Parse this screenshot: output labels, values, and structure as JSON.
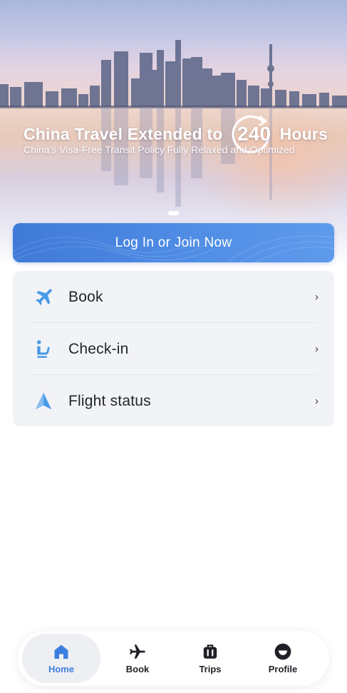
{
  "hero": {
    "title_before": "China Travel Extended to",
    "badge_number": "240",
    "title_after": "Hours",
    "subtitle": "China's Visa-Free Transit Policy Fully Relaxed and Optimized",
    "carousel": {
      "active_index": 0,
      "dot_count": 1
    }
  },
  "login": {
    "label": "Log In or Join Now"
  },
  "menu": {
    "items": [
      {
        "icon": "airplane-icon",
        "label": "Book",
        "chevron": "›"
      },
      {
        "icon": "seat-icon",
        "label": "Check-in",
        "chevron": "›"
      },
      {
        "icon": "navigation-arrow-icon",
        "label": "Flight status",
        "chevron": "›"
      }
    ]
  },
  "bottom_nav": {
    "items": [
      {
        "icon": "home-icon",
        "label": "Home",
        "active": true
      },
      {
        "icon": "airplane-icon",
        "label": "Book",
        "active": false
      },
      {
        "icon": "luggage-icon",
        "label": "Trips",
        "active": false
      },
      {
        "icon": "profile-icon",
        "label": "Profile",
        "active": false
      }
    ]
  },
  "colors": {
    "accent": "#3d7fe0",
    "icon_blue": "#4a9ae8",
    "button_gradient_start": "#3f7ad8",
    "button_gradient_end": "#5e9bec",
    "card_background": "#f2f3f7"
  }
}
